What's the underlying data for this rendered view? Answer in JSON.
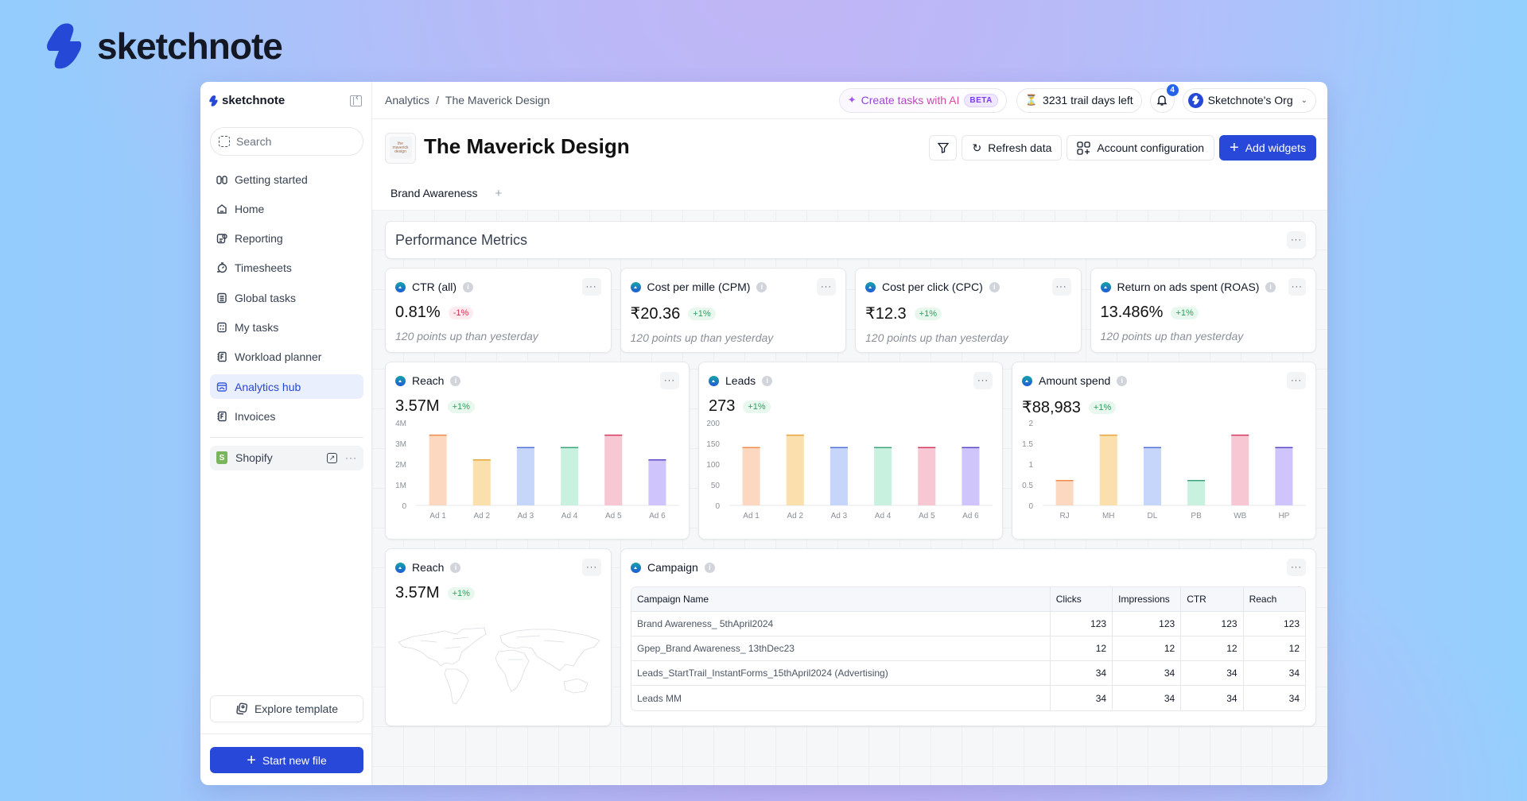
{
  "brand": {
    "name": "sketchnote",
    "color": "#2548d6"
  },
  "sidebar": {
    "brand_name": "sketchnote",
    "search_placeholder": "Search",
    "items": [
      {
        "label": "Getting started",
        "icon": "binoculars-icon",
        "active": false
      },
      {
        "label": "Home",
        "icon": "home-icon",
        "active": false
      },
      {
        "label": "Reporting",
        "icon": "report-icon",
        "active": false
      },
      {
        "label": "Timesheets",
        "icon": "stopwatch-icon",
        "active": false
      },
      {
        "label": "Global tasks",
        "icon": "clipboard-icon",
        "active": false
      },
      {
        "label": "My tasks",
        "icon": "checklist-icon",
        "active": false
      },
      {
        "label": "Workload planner",
        "icon": "notebook-icon",
        "active": false
      },
      {
        "label": "Analytics hub",
        "icon": "analytics-icon",
        "active": true
      },
      {
        "label": "Invoices",
        "icon": "invoice-icon",
        "active": false
      }
    ],
    "integration": {
      "label": "Shopify",
      "icon": "shopify-icon"
    },
    "explore_label": "Explore template",
    "start_new_label": "Start new file"
  },
  "topbar": {
    "breadcrumb": [
      "Analytics",
      "The Maverick Design"
    ],
    "breadcrumb_sep": "/",
    "ai_label": "Create tasks with AI",
    "ai_badge": "BETA",
    "trial_label": "3231 trail days left",
    "notifications_count": "4",
    "org_name": "Sketchnote's Org"
  },
  "page": {
    "title": "The Maverick Design",
    "logo_text": "the maverick design",
    "buttons": {
      "filter": "filter-icon",
      "refresh": "Refresh data",
      "account_config": "Account configuration",
      "add_widgets": "Add widgets"
    },
    "tabs": [
      {
        "label": "Brand Awareness",
        "active": true
      }
    ],
    "tab_add": "+"
  },
  "section": {
    "title": "Performance Metrics",
    "more": "···"
  },
  "metrics": [
    {
      "title": "CTR (all)",
      "value": "0.81%",
      "change": "-1%",
      "trend": "neg",
      "note": "120 points up than yesterday"
    },
    {
      "title": "Cost per mille (CPM)",
      "value": "₹20.36",
      "change": "+1%",
      "trend": "pos",
      "note": "120 points up than yesterday"
    },
    {
      "title": "Cost per click (CPC)",
      "value": "₹12.3",
      "change": "+1%",
      "trend": "pos",
      "note": "120 points up than yesterday"
    },
    {
      "title": "Return on ads spent (ROAS)",
      "value": "13.486%",
      "change": "+1%",
      "trend": "pos",
      "note": "120 points up than yesterday"
    }
  ],
  "charts_meta": [
    {
      "title": "Reach",
      "value": "3.57M",
      "change": "+1%"
    },
    {
      "title": "Leads",
      "value": "273",
      "change": "+1%"
    },
    {
      "title": "Amount spend",
      "value": "₹88,983",
      "change": "+1%"
    }
  ],
  "bar_colors": {
    "fills": [
      "#fdd8c0",
      "#fbe0ad",
      "#c6d6fb",
      "#c9f1e0",
      "#f7c8d3",
      "#cfc4fb"
    ],
    "tops": [
      "#f08a4b",
      "#e3a53c",
      "#5272d8",
      "#3aa37a",
      "#d6375d",
      "#5b48c9"
    ]
  },
  "chart_data": [
    {
      "type": "bar",
      "title": "Reach",
      "categories": [
        "Ad 1",
        "Ad 2",
        "Ad 3",
        "Ad 4",
        "Ad 5",
        "Ad 6"
      ],
      "values": [
        3400000,
        2200000,
        2800000,
        2800000,
        3400000,
        2200000
      ],
      "yticks": [
        "0",
        "1M",
        "2M",
        "3M",
        "4M"
      ],
      "ylim": [
        0,
        4000000
      ],
      "xlabel": "",
      "ylabel": ""
    },
    {
      "type": "bar",
      "title": "Leads",
      "categories": [
        "Ad 1",
        "Ad 2",
        "Ad 3",
        "Ad 4",
        "Ad 5",
        "Ad 6"
      ],
      "values": [
        140,
        170,
        140,
        140,
        140,
        140
      ],
      "yticks": [
        "0",
        "50",
        "100",
        "150",
        "200"
      ],
      "ylim": [
        0,
        200
      ],
      "xlabel": "",
      "ylabel": ""
    },
    {
      "type": "bar",
      "title": "Amount spend",
      "categories": [
        "RJ",
        "MH",
        "DL",
        "PB",
        "WB",
        "HP"
      ],
      "values": [
        0.6,
        1.7,
        1.4,
        0.6,
        1.7,
        1.4
      ],
      "yticks": [
        "0",
        "0.5",
        "1",
        "1.5",
        "2"
      ],
      "ylim": [
        0,
        2
      ],
      "xlabel": "",
      "ylabel": ""
    }
  ],
  "map_widget": {
    "title": "Reach",
    "value": "3.57M",
    "change": "+1%"
  },
  "campaign": {
    "title": "Campaign",
    "columns": [
      "Campaign Name",
      "Clicks",
      "Impressions",
      "CTR",
      "Reach"
    ],
    "rows": [
      [
        "Brand Awareness_ 5thApril2024",
        "123",
        "123",
        "123",
        "123"
      ],
      [
        "Gpep_Brand Awareness_ 13thDec23",
        "12",
        "12",
        "12",
        "12"
      ],
      [
        "Leads_StartTrail_InstantForms_15thApril2024 (Advertising)",
        "34",
        "34",
        "34",
        "34"
      ],
      [
        "Leads MM",
        "34",
        "34",
        "34",
        "34"
      ]
    ]
  }
}
